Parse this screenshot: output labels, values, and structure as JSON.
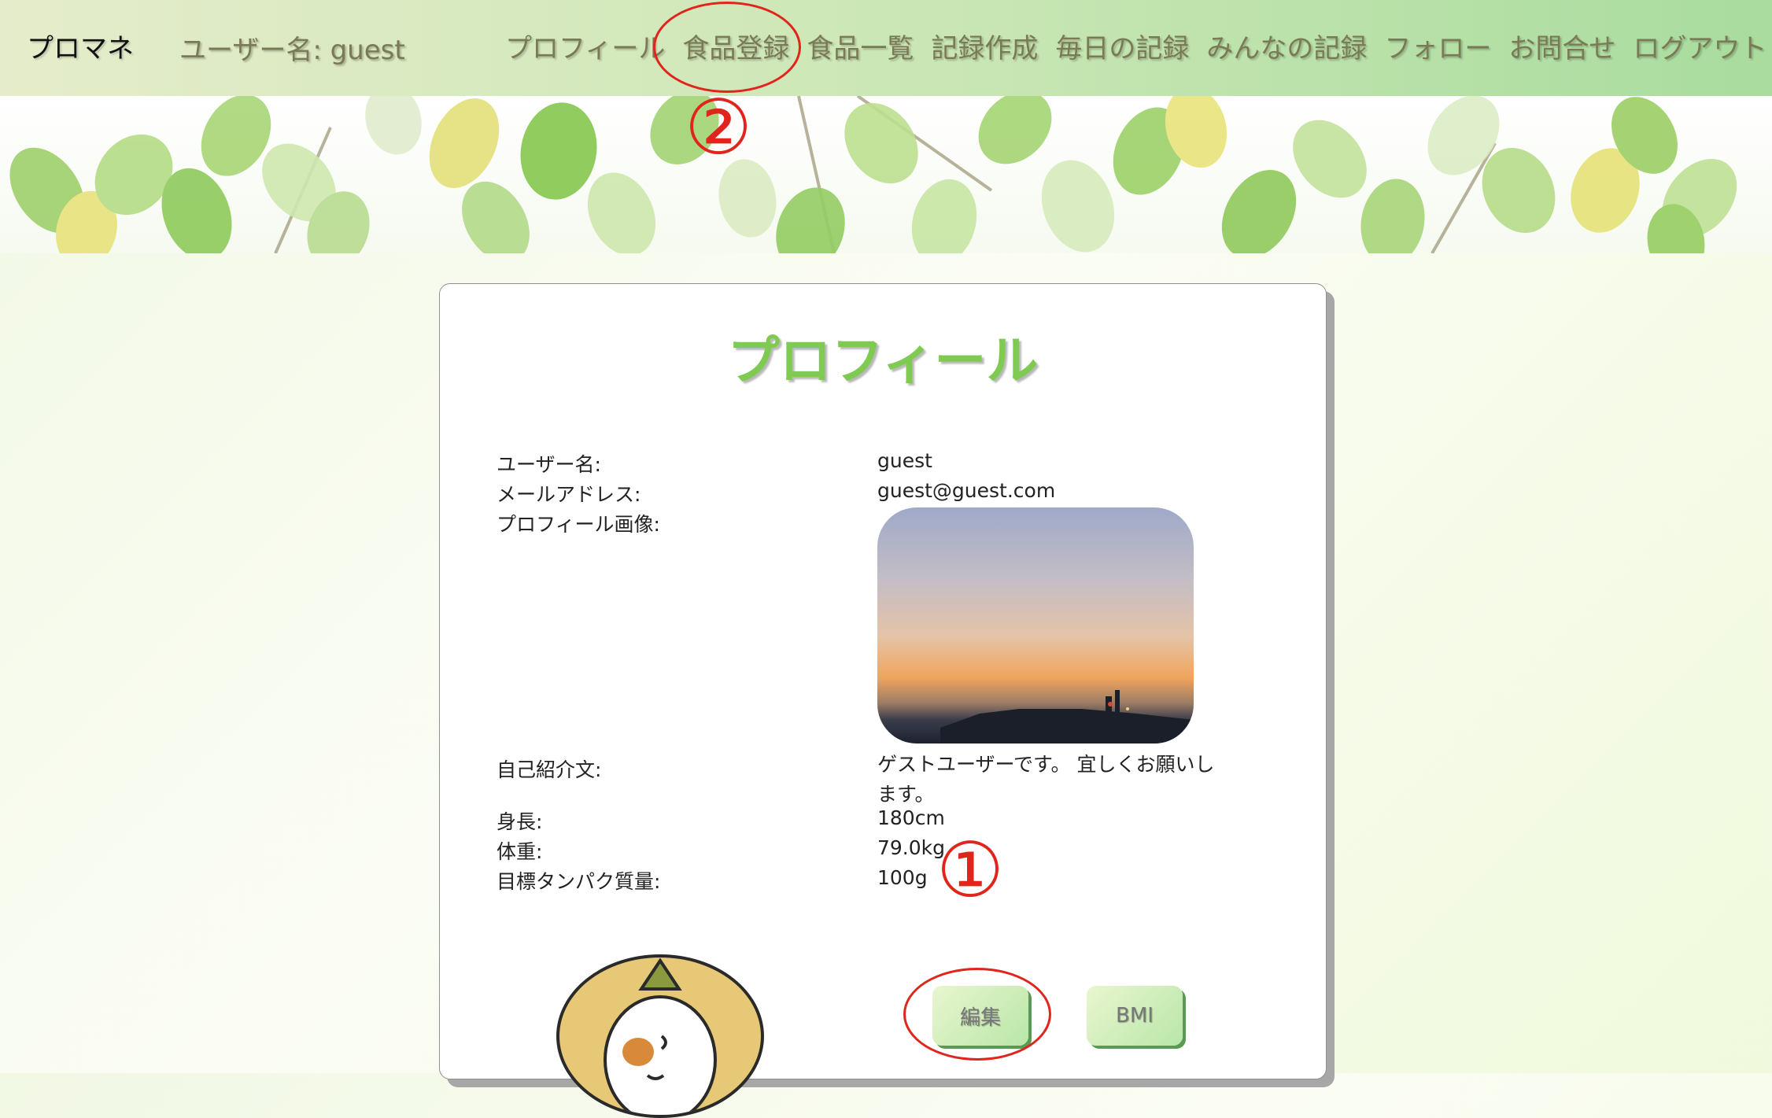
{
  "nav": {
    "brand": "プロマネ",
    "username_label": "ユーザー名: guest",
    "links": [
      "プロフィール",
      "食品登録",
      "食品一覧",
      "記録作成",
      "毎日の記録",
      "みんなの記録",
      "フォロー",
      "お問合せ",
      "ログアウト"
    ]
  },
  "card": {
    "title": "プロフィール",
    "fields": {
      "username": {
        "label": "ユーザー名:",
        "value": "guest"
      },
      "email": {
        "label": "メールアドレス:",
        "value": "guest@guest.com"
      },
      "image": {
        "label": "プロフィール画像:"
      },
      "bio": {
        "label": "自己紹介文:",
        "value": "ゲストユーザーです。 宜しくお願いします。"
      },
      "height": {
        "label": "身長:",
        "value": "180cm"
      },
      "weight": {
        "label": "体重:",
        "value": "79.0kg"
      },
      "protein": {
        "label": "目標タンパク質量:",
        "value": "100g"
      }
    },
    "buttons": {
      "edit": "編集",
      "bmi": "BMI"
    }
  },
  "annotations": {
    "one": "①",
    "two": "②",
    "color": "#e0261c"
  },
  "colors": {
    "title_green": "#7fcb52",
    "nav_text": "#7a7a55"
  }
}
